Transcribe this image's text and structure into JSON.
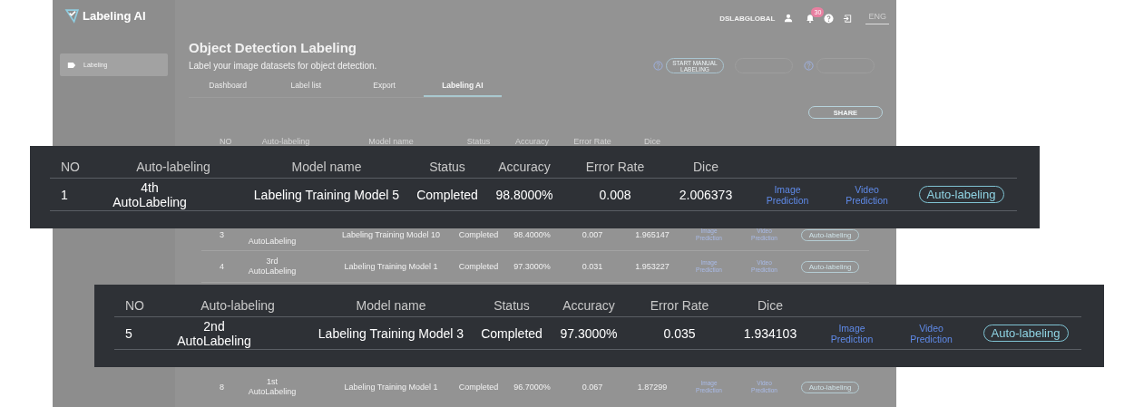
{
  "app": {
    "logo": "Labeling AI"
  },
  "sidebar": {
    "items": [
      {
        "label": "Labeling",
        "selected": true
      }
    ]
  },
  "topbar": {
    "user": "DSLABGLOBAL",
    "notification_count": "30",
    "language": "ENG"
  },
  "page": {
    "title": "Object Detection Labeling",
    "subtitle": "Label your image datasets for object detection.",
    "actions": [
      {
        "kind": "help"
      },
      {
        "kind": "button",
        "label": "START MANUAL LABELING"
      },
      {
        "kind": "blank"
      },
      {
        "kind": "help"
      },
      {
        "kind": "blank"
      }
    ]
  },
  "tabs": [
    {
      "label": "Dashboard",
      "selected": false
    },
    {
      "label": "Label list",
      "selected": false
    },
    {
      "label": "Export",
      "selected": false
    },
    {
      "label": "Labeling AI",
      "selected": true
    }
  ],
  "share_button": "SHARE",
  "table": {
    "columns": [
      "NO",
      "Auto-labeling",
      "Model name",
      "Status",
      "Accuracy",
      "Error Rate",
      "Dice"
    ],
    "rows": [
      {
        "no": "3",
        "auto_labeling": "AutoLabeling",
        "model": "Labeling Training Model 10",
        "status": "Completed",
        "accuracy": "98.4000%",
        "error_rate": "0.007",
        "dice": "1.965147",
        "image_link": "Image Prediction",
        "video_link": "Video Prediction",
        "action": "Auto-labeling"
      },
      {
        "no": "4",
        "auto_labeling": "3rd AutoLabeling",
        "model": "Labeling Training Model 1",
        "status": "Completed",
        "accuracy": "97.3000%",
        "error_rate": "0.031",
        "dice": "1.953227",
        "image_link": "Image Prediction",
        "video_link": "Video Prediction",
        "action": "Auto-labeling"
      },
      {
        "no": "8",
        "auto_labeling": "1st AutoLabeling",
        "model": "Labeling Training Model 1",
        "status": "Completed",
        "accuracy": "96.7000%",
        "error_rate": "0.067",
        "dice": "1.87299",
        "image_link": "Image Prediction",
        "video_link": "Video Prediction",
        "action": "Auto-labeling"
      }
    ]
  },
  "zoomed_rows": [
    {
      "columns": [
        "NO",
        "Auto-labeling",
        "Model name",
        "Status",
        "Accuracy",
        "Error Rate",
        "Dice"
      ],
      "row": {
        "no": "1",
        "auto_labeling": "4th AutoLabeling",
        "model": "Labeling Training Model 5",
        "status": "Completed",
        "accuracy": "98.8000%",
        "error_rate": "0.008",
        "dice": "2.006373",
        "image_link": "Image Prediction",
        "video_link": "Video Prediction",
        "action": "Auto-labeling"
      }
    },
    {
      "columns": [
        "NO",
        "Auto-labeling",
        "Model name",
        "Status",
        "Accuracy",
        "Error Rate",
        "Dice"
      ],
      "row": {
        "no": "5",
        "auto_labeling": "2nd AutoLabeling",
        "model": "Labeling Training Model 3",
        "status": "Completed",
        "accuracy": "97.3000%",
        "error_rate": "0.035",
        "dice": "1.934103",
        "image_link": "Image Prediction",
        "video_link": "Video Prediction",
        "action": "Auto-labeling"
      }
    }
  ]
}
